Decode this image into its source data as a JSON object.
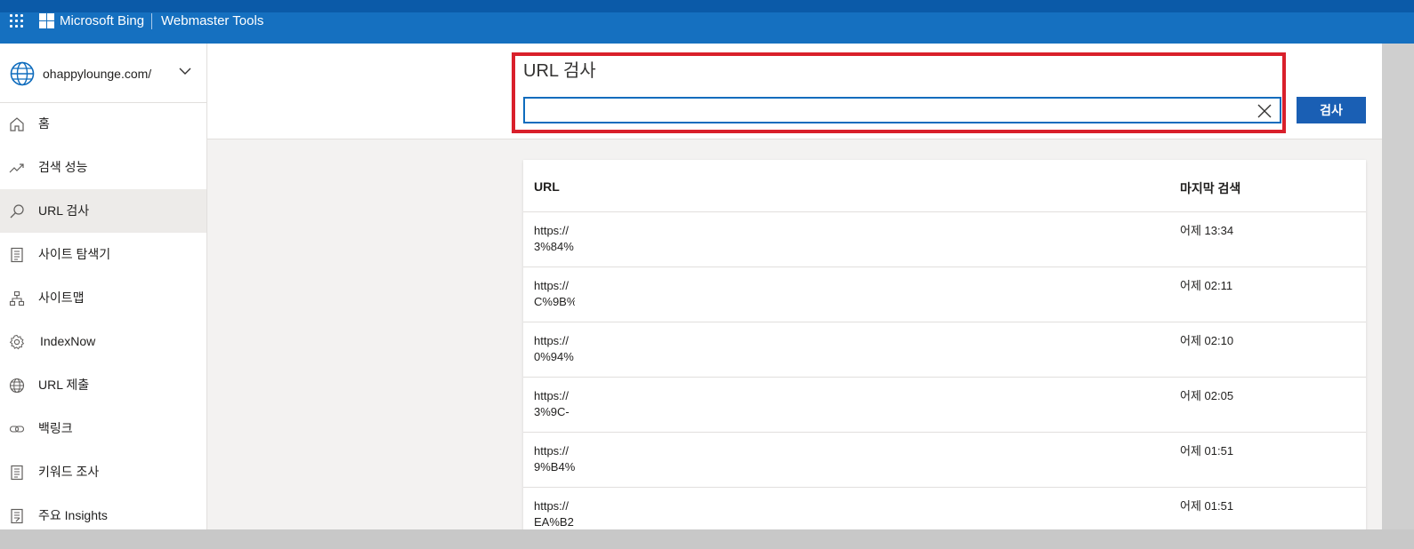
{
  "topbar": {
    "brand": "Microsoft Bing",
    "product": "Webmaster Tools",
    "bg_color": "#1570c0"
  },
  "site_picker": {
    "site": "ohappylounge.com/",
    "icon": "globe-icon"
  },
  "sidebar": {
    "items": [
      {
        "label": "홈",
        "icon": "home-icon"
      },
      {
        "label": "검색 성능",
        "icon": "trending-icon"
      },
      {
        "label": "URL 검사",
        "icon": "search-icon",
        "active": true
      },
      {
        "label": "사이트 탐색기",
        "icon": "document-icon"
      },
      {
        "label": "사이트맵",
        "icon": "sitemap-icon"
      },
      {
        "label": "IndexNow",
        "icon": "gear-icon"
      },
      {
        "label": "URL 제출",
        "icon": "globe-icon"
      },
      {
        "label": "백링크",
        "icon": "link-icon"
      },
      {
        "label": "키워드 조사",
        "icon": "document-icon"
      },
      {
        "label": "주요 Insights",
        "icon": "document-icon"
      }
    ]
  },
  "main": {
    "title": "URL 검사",
    "search": {
      "value": "",
      "placeholder": ""
    },
    "search_button": "검사",
    "highlight_color": "#d9202b"
  },
  "table": {
    "columns": [
      "URL",
      "마지막 검색"
    ],
    "rows": [
      {
        "url_line1": "https://",
        "url_line2": "3%84%",
        "time": "어제 13:34"
      },
      {
        "url_line1": "https://",
        "url_line2": "C%9B%",
        "time": "어제 02:11"
      },
      {
        "url_line1": "https://",
        "url_line2": "0%94%",
        "time": "어제 02:10"
      },
      {
        "url_line1": "https://",
        "url_line2": "3%9C-",
        "time": "어제 02:05"
      },
      {
        "url_line1": "https://",
        "url_line2": "9%B4%",
        "time": "어제 01:51"
      },
      {
        "url_line1": "https://",
        "url_line2": "EA%B2",
        "time": "어제 01:51"
      }
    ]
  }
}
